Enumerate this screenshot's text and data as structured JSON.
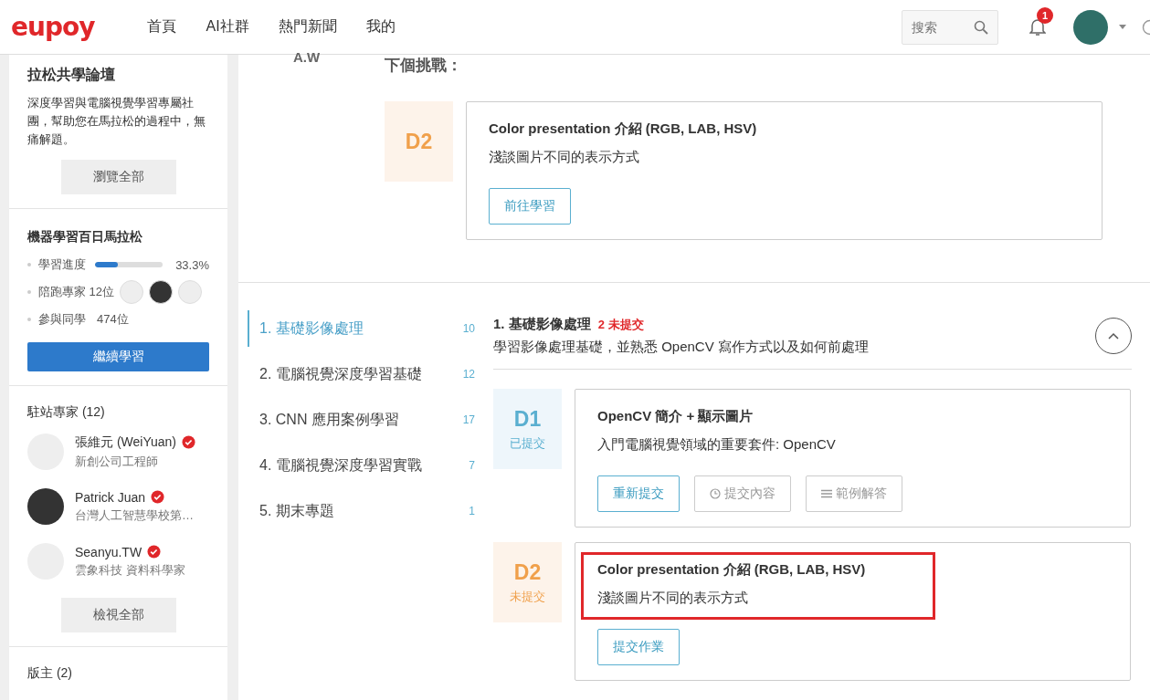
{
  "header": {
    "logo": "eupoy",
    "nav": [
      "首頁",
      "AI社群",
      "熱門新聞",
      "我的"
    ],
    "search": {
      "placeholder": "搜索"
    },
    "notifications": {
      "count": "1"
    }
  },
  "sidebar": {
    "forum": {
      "title": "拉松共學論壇",
      "description": "深度學習與電腦視覺學習專屬社團，幫助您在馬拉松的過程中，無痛解題。",
      "button": "瀏覽全部"
    },
    "marathon": {
      "title": "機器學習百日馬拉松",
      "progress": {
        "label": "學習進度",
        "level": 0.333,
        "reading": "33.3%"
      },
      "mentors": {
        "label": "陪跑專家 12位"
      },
      "students": {
        "label": "參與同學",
        "value": "474位"
      },
      "button": "繼續學習"
    },
    "experts": {
      "title": "駐站專家 (12)",
      "items": [
        {
          "name": "張維元 (WeiYuan)",
          "role": "新創公司工程師",
          "verified": true
        },
        {
          "name": "Patrick Juan",
          "role": "台灣人工智慧學校第…",
          "verified": true
        },
        {
          "name": "Seanyu.TW",
          "role": "雲象科技 資料科學家",
          "verified": true
        }
      ],
      "button": "檢視全部"
    },
    "moderators": {
      "title": "版主 (2)"
    }
  },
  "main": {
    "author": "A.W",
    "next_label": "下個挑戰：",
    "next": {
      "day": "D2",
      "title": "Color presentation 介紹 (RGB, LAB, HSV)",
      "description": "淺談圖片不同的表示方式",
      "button": "前往學習"
    },
    "chapters": [
      {
        "label": "1. 基礎影像處理",
        "count": "10",
        "selected": true
      },
      {
        "label": "2. 電腦視覺深度學習基礎",
        "count": "12",
        "selected": false
      },
      {
        "label": "3. CNN 應用案例學習",
        "count": "17",
        "selected": false
      },
      {
        "label": "4. 電腦視覺深度學習實戰",
        "count": "7",
        "selected": false
      },
      {
        "label": "5. 期末專題",
        "count": "1",
        "selected": false
      }
    ],
    "section": {
      "title": "1. 基礎影像處理",
      "pending": "2 未提交",
      "description": "學習影像處理基礎，並熟悉 OpenCV 寫作方式以及如何前處理",
      "expanded": true
    },
    "days": [
      {
        "day": "D1",
        "status": "已提交",
        "submitted": true,
        "highlighted": false,
        "title": "OpenCV 簡介 + 顯示圖片",
        "description": "入門電腦視覺領域的重要套件: OpenCV",
        "buttons": [
          {
            "label": "重新提交",
            "kind": "primary"
          },
          {
            "label": "提交內容",
            "kind": "history"
          },
          {
            "label": "範例解答",
            "kind": "solution"
          }
        ]
      },
      {
        "day": "D2",
        "status": "未提交",
        "submitted": false,
        "highlighted": true,
        "title": "Color presentation 介紹 (RGB, LAB, HSV)",
        "description": "淺談圖片不同的表示方式",
        "buttons": [
          {
            "label": "提交作業",
            "kind": "primary"
          }
        ]
      }
    ]
  }
}
